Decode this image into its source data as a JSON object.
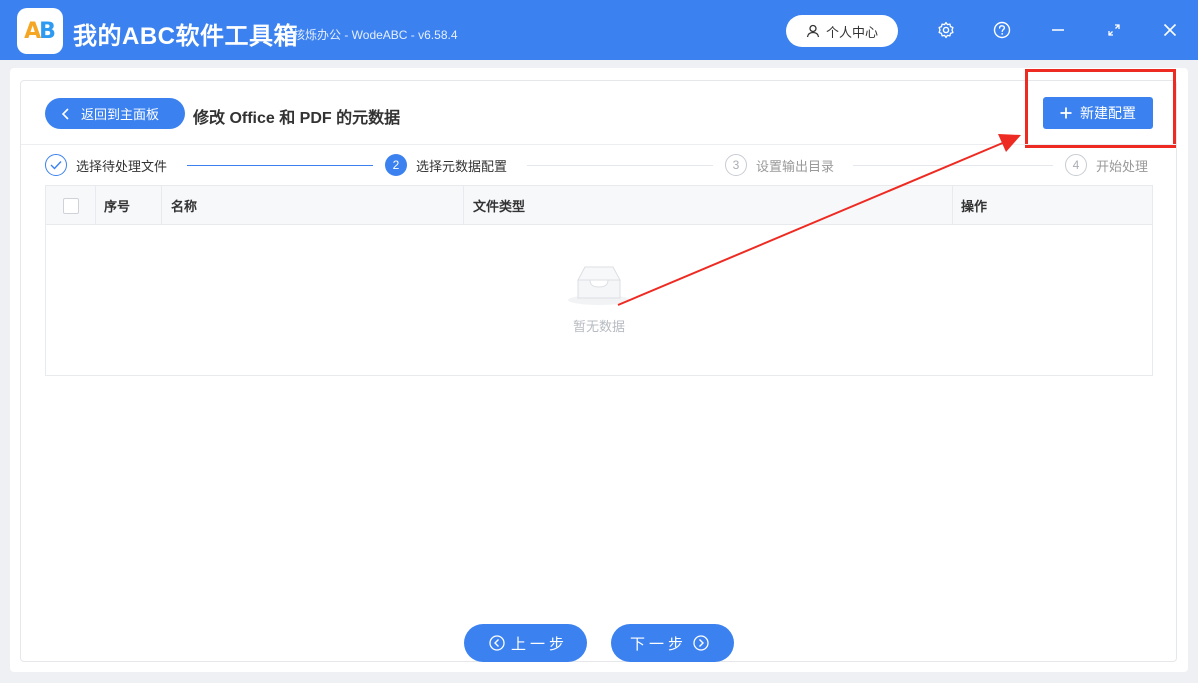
{
  "app": {
    "title": "我的ABC软件工具箱",
    "subtitle": "核烁办公 - WodeABC - v6.58.4",
    "logo_a": "A",
    "logo_b": "B",
    "user_center": "个人中心",
    "window_icons": [
      "settings-icon",
      "help-icon",
      "minimize-icon",
      "maximize-icon",
      "close-icon"
    ]
  },
  "toolbar": {
    "back_label": "返回到主面板",
    "page_title": "修改 Office 和 PDF 的元数据",
    "new_config_label": "新建配置"
  },
  "steps": [
    {
      "num": "1",
      "label": "选择待处理文件",
      "state": "done"
    },
    {
      "num": "2",
      "label": "选择元数据配置",
      "state": "active"
    },
    {
      "num": "3",
      "label": "设置输出目录",
      "state": "todo"
    },
    {
      "num": "4",
      "label": "开始处理",
      "state": "todo"
    }
  ],
  "table": {
    "columns": [
      "序号",
      "名称",
      "文件类型",
      "操作"
    ],
    "empty_text": "暂无数据"
  },
  "nav": {
    "prev_label": "上一步",
    "next_label": "下一步"
  },
  "colors": {
    "primary": "#3b82f0",
    "highlight": "#ee2b22"
  }
}
